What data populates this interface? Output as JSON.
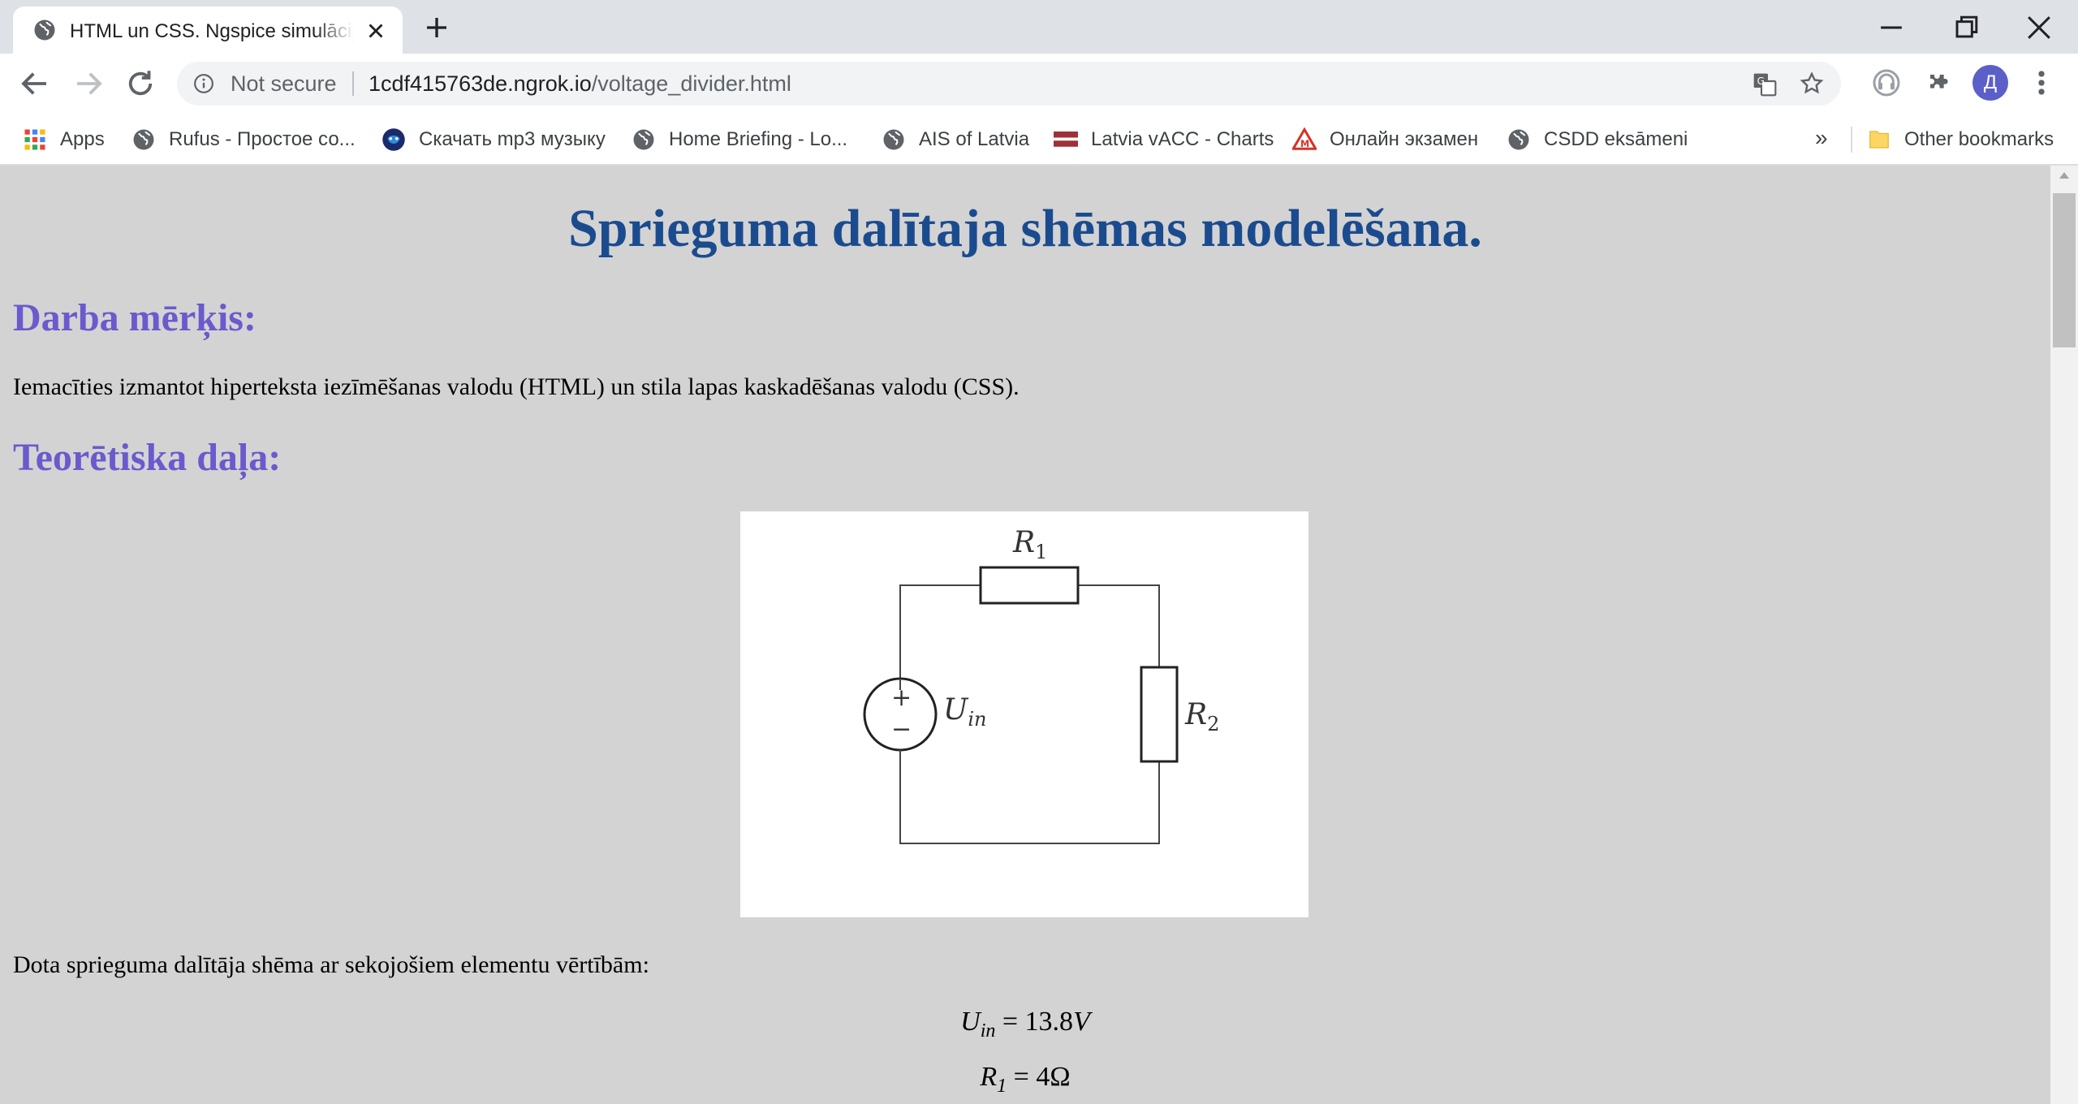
{
  "browser": {
    "tab_title": "HTML un CSS. Ngspice simulācija",
    "new_tab_icon": "plus-icon",
    "omnibox": {
      "security_label": "Not secure",
      "url_host": "1cdf415763de.ngrok.io",
      "url_path": "/voltage_divider.html"
    },
    "avatar_letter": "Д",
    "bookmarks": [
      {
        "label": "Apps",
        "icon": "apps-grid-icon"
      },
      {
        "label": "Rufus - Простое со...",
        "icon": "globe-icon"
      },
      {
        "label": "Скачать mp3 музыку",
        "icon": "music-site-icon"
      },
      {
        "label": "Home Briefing - Lo...",
        "icon": "globe-icon"
      },
      {
        "label": "AIS of Latvia",
        "icon": "globe-icon"
      },
      {
        "label": "Latvia vACC - Charts",
        "icon": "latvia-flag-icon"
      },
      {
        "label": "Онлайн экзамен",
        "icon": "warning-sign-icon"
      },
      {
        "label": "CSDD eksāmeni",
        "icon": "globe-icon"
      }
    ],
    "bookmarks_overflow": "»",
    "other_bookmarks": "Other bookmarks"
  },
  "page": {
    "title": "Sprieguma dalītaja shēmas modelēšana.",
    "goal_heading": "Darba mērķis:",
    "goal_text": "Iemacīties izmantot hiperteksta iezīmēšanas valodu (HTML) un stila lapas kaskadēšanas valodu (CSS).",
    "theory_heading": "Teorētiska daļa:",
    "circuit": {
      "r1_label": "R",
      "r1_sub": "1",
      "r2_label": "R",
      "r2_sub": "2",
      "source_label": "U",
      "source_sub": "in",
      "plus": "+",
      "minus": "−"
    },
    "values_intro": "Dota sprieguma dalītāja shēma ar sekojošiem elementu vērtībām:",
    "eq1": {
      "symbol": "U",
      "sub": "in",
      "value": "= 13.8",
      "unit": "V"
    },
    "eq2": {
      "symbol": "R",
      "sub": "1",
      "value": "= 4Ω"
    }
  },
  "colors": {
    "page_bg": "#d3d3d3",
    "title": "#1b4b8f",
    "heading": "#6a5acd",
    "avatar": "#5b5fc7"
  }
}
